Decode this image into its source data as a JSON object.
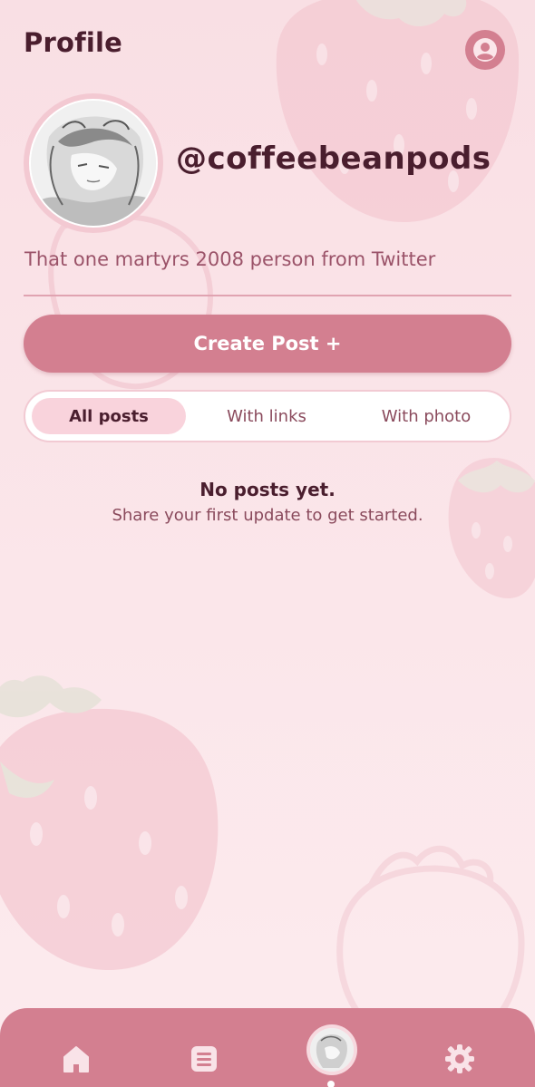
{
  "header": {
    "title": "Profile",
    "account_icon": "user-circle-icon"
  },
  "profile": {
    "username": "@coffeebeanpods",
    "bio": "That one martyrs 2008 person from Twitter",
    "avatar": "sketched-character-avatar"
  },
  "actions": {
    "create_post_label": "Create Post +"
  },
  "filters": {
    "tabs": [
      {
        "label": "All posts",
        "active": true
      },
      {
        "label": "With links",
        "active": false
      },
      {
        "label": "With photo",
        "active": false
      }
    ]
  },
  "empty_state": {
    "title": "No posts yet.",
    "subtitle": "Share your first update to get started."
  },
  "bottom_nav": {
    "items": [
      {
        "icon": "home-icon",
        "active": false
      },
      {
        "icon": "list-icon",
        "active": false
      },
      {
        "icon": "profile-avatar",
        "active": true
      },
      {
        "icon": "gear-icon",
        "active": false
      }
    ]
  },
  "colors": {
    "accent": "#d37f90",
    "text_dark": "#4a1e2e",
    "text_muted": "#9b5369",
    "background": "#f9dfe4",
    "tab_active": "#f9d3dc"
  }
}
